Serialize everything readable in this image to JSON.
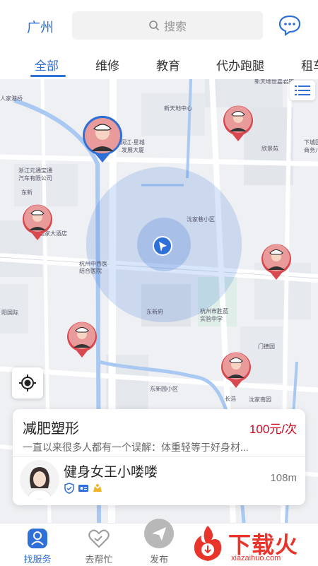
{
  "header": {
    "city": "广州",
    "search_placeholder": "搜索"
  },
  "tabs": [
    "全部",
    "维修",
    "教育",
    "代办跑腿",
    "租车"
  ],
  "map": {
    "labels": [
      "新天地世嘉君座",
      "新天地中心",
      "润江·星城",
      "发展大厦",
      "欣景苑",
      "下城区",
      "商务八",
      "浙江元通宝通",
      "汽车有限公司",
      "东新",
      "国家大酒店",
      "沈家巷小区",
      "杭州中西医",
      "结合医院",
      "杭州市胜蓝",
      "实验中学",
      "东新府",
      "门德园",
      "东新园小区",
      "沈家南园",
      "长浩",
      "阳国际",
      "人家港桥"
    ]
  },
  "card": {
    "title": "减肥塑形",
    "price": "100元/次",
    "description": "一直以来很多人都有一个误解：体重轻等于好身材...",
    "user_name": "健身女王小喽喽",
    "distance": "108m"
  },
  "bottom_nav": [
    {
      "label": "找服务"
    },
    {
      "label": "去帮忙"
    },
    {
      "label": "发布"
    }
  ],
  "watermark": {
    "text": "下载火",
    "url": "xiazaihuo.com"
  },
  "colors": {
    "accent": "#2f6fd8",
    "price": "#d0021b",
    "brand_red": "#e8342a"
  }
}
